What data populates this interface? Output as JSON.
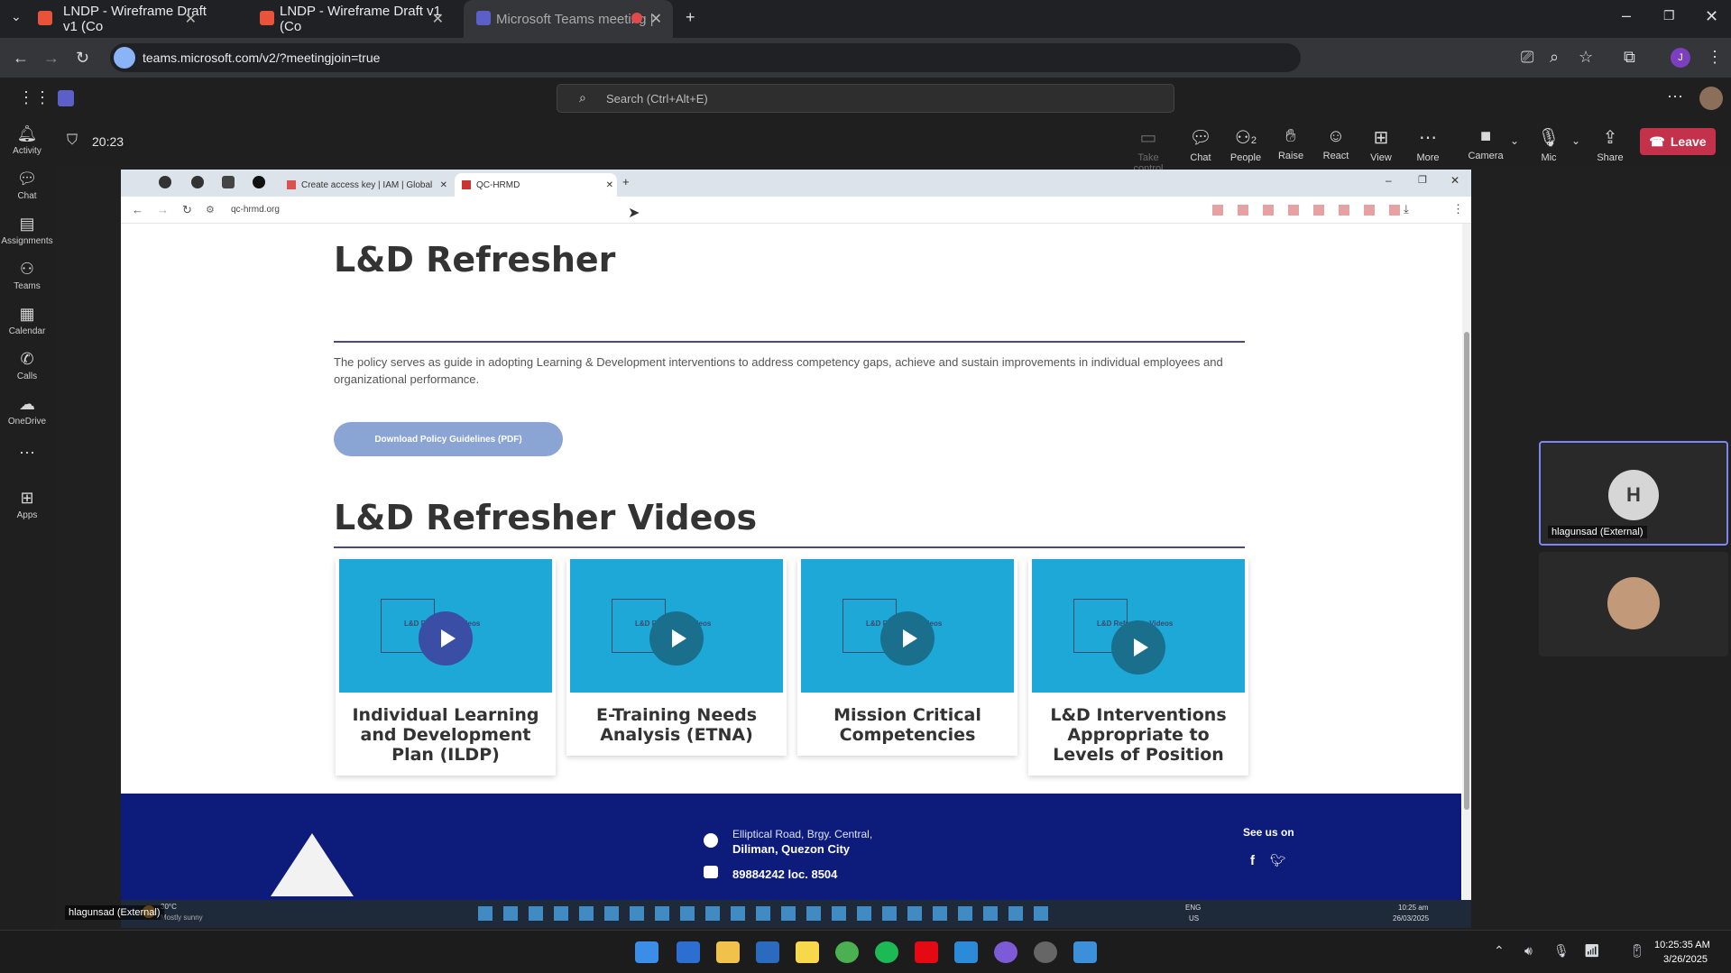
{
  "browser": {
    "tabs": [
      {
        "label": "LNDP - Wireframe Draft v1 (Co",
        "color": "#e8533a"
      },
      {
        "label": "LNDP - Wireframe Draft v1 (Co",
        "color": "#e8533a"
      },
      {
        "label": "Microsoft Teams meeting |",
        "color": "#5b5fc7"
      }
    ],
    "url": "teams.microsoft.com/v2/?meetingjoin=true"
  },
  "teams": {
    "search_placeholder": "Search (Ctrl+Alt+E)",
    "rail": [
      "Activity",
      "Chat",
      "Assignments",
      "Teams",
      "Calendar",
      "Calls",
      "OneDrive",
      "Apps"
    ],
    "timer": "20:23",
    "controls": [
      "Take control",
      "Chat",
      "People",
      "Raise",
      "React",
      "View",
      "More",
      "Camera",
      "Mic",
      "Share"
    ],
    "people_count": "2",
    "leave_label": "Leave"
  },
  "shared": {
    "tabs": [
      "Create access key | IAM | Global",
      "QC-HRMD"
    ],
    "url": "qc-hrmd.org",
    "heading": "L&D Refresher",
    "policy_text": "The policy serves as guide in adopting Learning & Development interventions to address competency gaps, achieve and sustain improvements in individual employees and organizational performance.",
    "download_label": "Download Policy Guidelines (PDF)",
    "videos_heading": "L&D Refresher Videos",
    "thumb_caption": "L&D Refresher Videos",
    "cards": [
      "Individual Learning and Development Plan (ILDP)",
      "E-Training Needs Analysis (ETNA)",
      "Mission Critical Competencies",
      "L&D Interventions Appropriate to Levels of Position"
    ],
    "footer": {
      "address_line1": "Elliptical Road, Brgy. Central,",
      "address_line2": "Diliman, Quezon City",
      "phone": "89884242 loc. 8504",
      "see_us": "See us on"
    },
    "taskbar_lang": "ENG",
    "taskbar_region": "US",
    "taskbar_time": "10:25 am",
    "taskbar_date": "26/03/2025",
    "weather_temp": "30°C",
    "weather_desc": "Mostly sunny"
  },
  "participants": [
    {
      "initial": "H",
      "name": "hlagunsad (External)"
    }
  ],
  "presenter_label": "hlagunsad (External)",
  "clock": {
    "time": "10:25:35 AM",
    "date": "3/26/2025"
  }
}
